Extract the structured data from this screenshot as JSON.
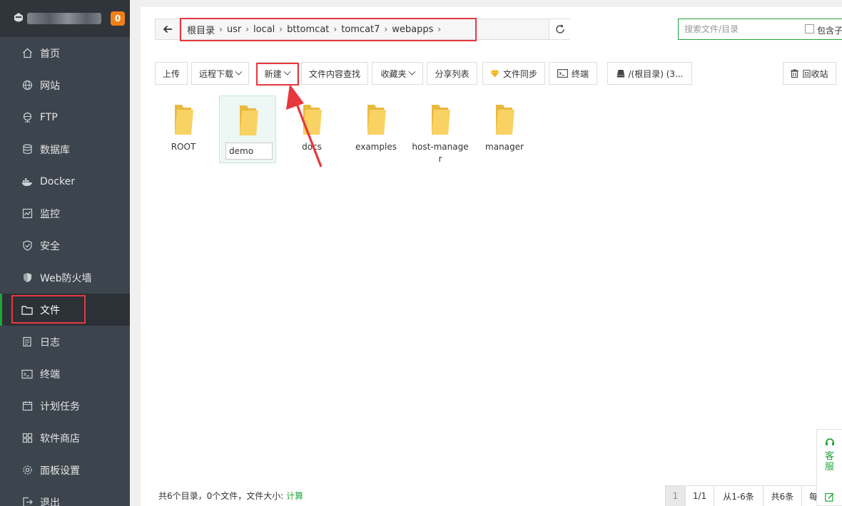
{
  "sidebar": {
    "badge": "0",
    "items": [
      {
        "label": "首页",
        "icon": "home-icon"
      },
      {
        "label": "网站",
        "icon": "globe-icon"
      },
      {
        "label": "FTP",
        "icon": "ftp-icon"
      },
      {
        "label": "数据库",
        "icon": "database-icon"
      },
      {
        "label": "Docker",
        "icon": "docker-icon"
      },
      {
        "label": "监控",
        "icon": "monitor-icon"
      },
      {
        "label": "安全",
        "icon": "shield-icon"
      },
      {
        "label": "Web防火墙",
        "icon": "firewall-icon"
      },
      {
        "label": "文件",
        "icon": "folder-icon",
        "active": true
      },
      {
        "label": "日志",
        "icon": "log-icon"
      },
      {
        "label": "终端",
        "icon": "terminal-icon"
      },
      {
        "label": "计划任务",
        "icon": "calendar-icon"
      },
      {
        "label": "软件商店",
        "icon": "apps-icon"
      },
      {
        "label": "面板设置",
        "icon": "gear-icon"
      },
      {
        "label": "退出",
        "icon": "logout-icon"
      }
    ]
  },
  "path": {
    "crumbs": [
      "根目录",
      "usr",
      "local",
      "bttomcat",
      "tomcat7",
      "webapps"
    ]
  },
  "search": {
    "placeholder": "搜索文件/目录",
    "include_sub_label": "包含子"
  },
  "toolbar": {
    "upload": "上传",
    "remote_download": "远程下载",
    "new": "新建",
    "content_search": "文件内容查找",
    "favorites": "收藏夹",
    "share_list": "分享列表",
    "file_sync": "文件同步",
    "terminal": "终端",
    "disk": "/(根目录) (3...",
    "recycle_bin": "回收站"
  },
  "files": [
    {
      "name": "ROOT"
    },
    {
      "name": "",
      "rename_value": "demo",
      "selected": true
    },
    {
      "name": "docs"
    },
    {
      "name": "examples"
    },
    {
      "name": "host-manager"
    },
    {
      "name": "manager"
    }
  ],
  "footer": {
    "summary": "共6个目录，0个文件，文件大小:",
    "calc": "计算"
  },
  "pagination": {
    "current_page": "1",
    "page_of": "1/1",
    "range": "从1-6条",
    "total": "共6条",
    "per_page_prefix": "每"
  },
  "support": {
    "label": "客服"
  },
  "colors": {
    "brand_green": "#20a53a",
    "highlight_red": "#e6383d",
    "sidebar_bg": "#3c444d",
    "folder_yellow": "#f7cf5b",
    "badge_orange": "#f0811a"
  }
}
